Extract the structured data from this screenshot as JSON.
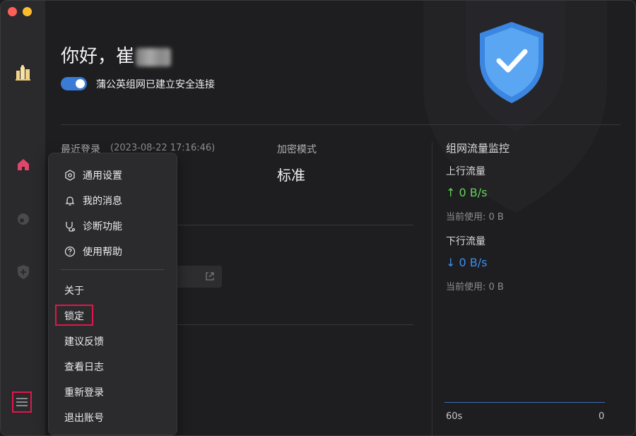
{
  "window": {
    "controls": [
      "close",
      "minimize"
    ]
  },
  "sidebar": {
    "items": [
      {
        "name": "logo-icon"
      },
      {
        "name": "home-icon",
        "color": "#e0456a"
      },
      {
        "name": "network-icon"
      },
      {
        "name": "shield-plus-icon"
      }
    ],
    "menu_icon": "menu-icon"
  },
  "header": {
    "greeting_prefix": "你好，崔",
    "connection_status": "蒲公英组网已建立安全连接",
    "toggle_on": true
  },
  "info": {
    "last_login_label": "最近登录",
    "last_login_time": "(2023-08-22 17:16:46)",
    "encryption_label": "加密模式",
    "encryption_value": "标准"
  },
  "traffic": {
    "title": "组网流量监控",
    "up_label": "上行流量",
    "up_rate": "↑ 0 B/s",
    "up_used": "当前使用: 0 B",
    "down_label": "下行流量",
    "down_rate": "↓ 0 B/s",
    "down_used": "当前使用: 0 B",
    "chart_left": "60s",
    "chart_right": "0"
  },
  "menu": {
    "group1": [
      {
        "label": "通用设置",
        "icon": "settings-icon"
      },
      {
        "label": "我的消息",
        "icon": "bell-icon"
      },
      {
        "label": "诊断功能",
        "icon": "stethoscope-icon"
      },
      {
        "label": "使用帮助",
        "icon": "help-icon"
      }
    ],
    "group2": [
      {
        "label": "关于"
      },
      {
        "label": "锁定",
        "highlighted": true
      },
      {
        "label": "建议反馈"
      },
      {
        "label": "查看日志"
      },
      {
        "label": "重新登录"
      },
      {
        "label": "退出账号"
      }
    ]
  },
  "colors": {
    "accent": "#3a7bd5",
    "highlight_border": "#e0174a",
    "up_green": "#66d25c",
    "down_blue": "#3d8ef0"
  }
}
